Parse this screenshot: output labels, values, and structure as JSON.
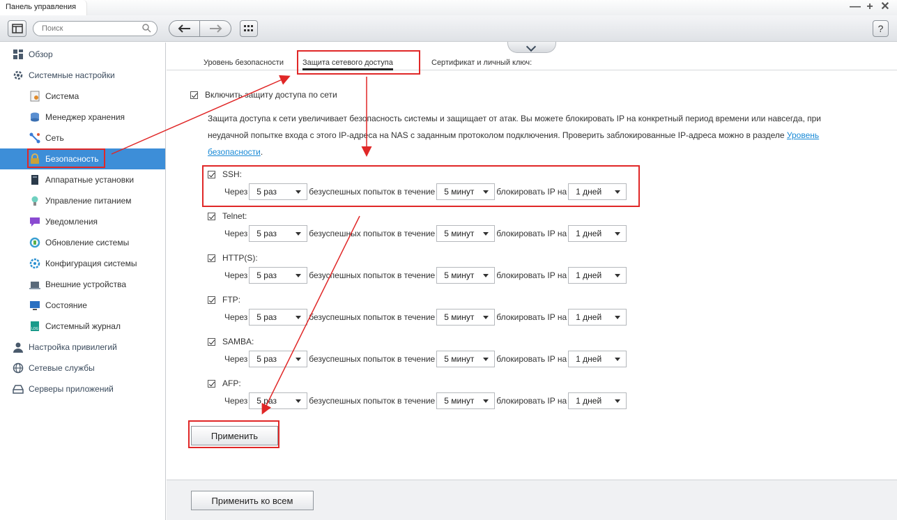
{
  "window": {
    "title": "Панель управления"
  },
  "toolbar": {
    "search_placeholder": "Поиск",
    "help_label": "?"
  },
  "sidebar": {
    "items": [
      {
        "label": "Обзор",
        "level": "top",
        "icon": "overview-icon"
      },
      {
        "label": "Системные настройки",
        "level": "top",
        "icon": "gear-icon"
      },
      {
        "label": "Система",
        "level": "sub",
        "icon": "system-icon"
      },
      {
        "label": "Менеджер хранения",
        "level": "sub",
        "icon": "storage-icon"
      },
      {
        "label": "Сеть",
        "level": "sub",
        "icon": "network-icon"
      },
      {
        "label": "Безопасность",
        "level": "sub",
        "icon": "lock-icon",
        "active": true
      },
      {
        "label": "Аппаратные установки",
        "level": "sub",
        "icon": "hardware-icon"
      },
      {
        "label": "Управление питанием",
        "level": "sub",
        "icon": "power-icon"
      },
      {
        "label": "Уведомления",
        "level": "sub",
        "icon": "notification-icon"
      },
      {
        "label": "Обновление системы",
        "level": "sub",
        "icon": "update-icon"
      },
      {
        "label": "Конфигурация системы",
        "level": "sub",
        "icon": "config-icon"
      },
      {
        "label": "Внешние устройства",
        "level": "sub",
        "icon": "external-device-icon"
      },
      {
        "label": "Состояние",
        "level": "sub",
        "icon": "monitor-icon"
      },
      {
        "label": "Системный журнал",
        "level": "sub",
        "icon": "log-icon"
      },
      {
        "label": "Настройка привилегий",
        "level": "top",
        "icon": "user-icon"
      },
      {
        "label": "Сетевые службы",
        "level": "top",
        "icon": "globe-icon"
      },
      {
        "label": "Серверы приложений",
        "level": "top",
        "icon": "server-icon"
      }
    ]
  },
  "tabs": [
    {
      "label": "Уровень безопасности"
    },
    {
      "label": "Защита сетевого доступа",
      "active": true
    },
    {
      "label": "Сертификат и личный ключ:"
    }
  ],
  "enable_label": "Включить защиту доступа по сети",
  "description": {
    "text": "Защита доступа к сети увеличивает безопасность системы и защищает от атак. Вы можете блокировать IP на конкретный период времени или навсегда, при неудачной попытке входа с этого IP-адреса на NAS с заданным протоколом подключения. Проверить заблокированные IP-адреса можно в разделе ",
    "link": "Уровень безопасности",
    "end": "."
  },
  "rule_text": {
    "via": "Через",
    "attempts_within": "безуспешных попыток в течение",
    "block_ip_for": "блокировать IP на"
  },
  "protocols": [
    {
      "name": "SSH:",
      "attempts": "5 раз",
      "period": "5 минут",
      "block": "1 дней",
      "checked": true
    },
    {
      "name": "Telnet:",
      "attempts": "5 раз",
      "period": "5 минут",
      "block": "1 дней",
      "checked": true
    },
    {
      "name": "HTTP(S):",
      "attempts": "5 раз",
      "period": "5 минут",
      "block": "1 дней",
      "checked": true
    },
    {
      "name": "FTP:",
      "attempts": "5 раз",
      "period": "5 минут",
      "block": "1 дней",
      "checked": true
    },
    {
      "name": "SAMBA:",
      "attempts": "5 раз",
      "period": "5 минут",
      "block": "1 дней",
      "checked": true
    },
    {
      "name": "AFP:",
      "attempts": "5 раз",
      "period": "5 минут",
      "block": "1 дней",
      "checked": true
    }
  ],
  "apply_label": "Применить",
  "apply_all_label": "Применить ко всем",
  "colors": {
    "accent": "#3d8ed8",
    "annotation": "#e02727",
    "link": "#1a8ad6"
  }
}
